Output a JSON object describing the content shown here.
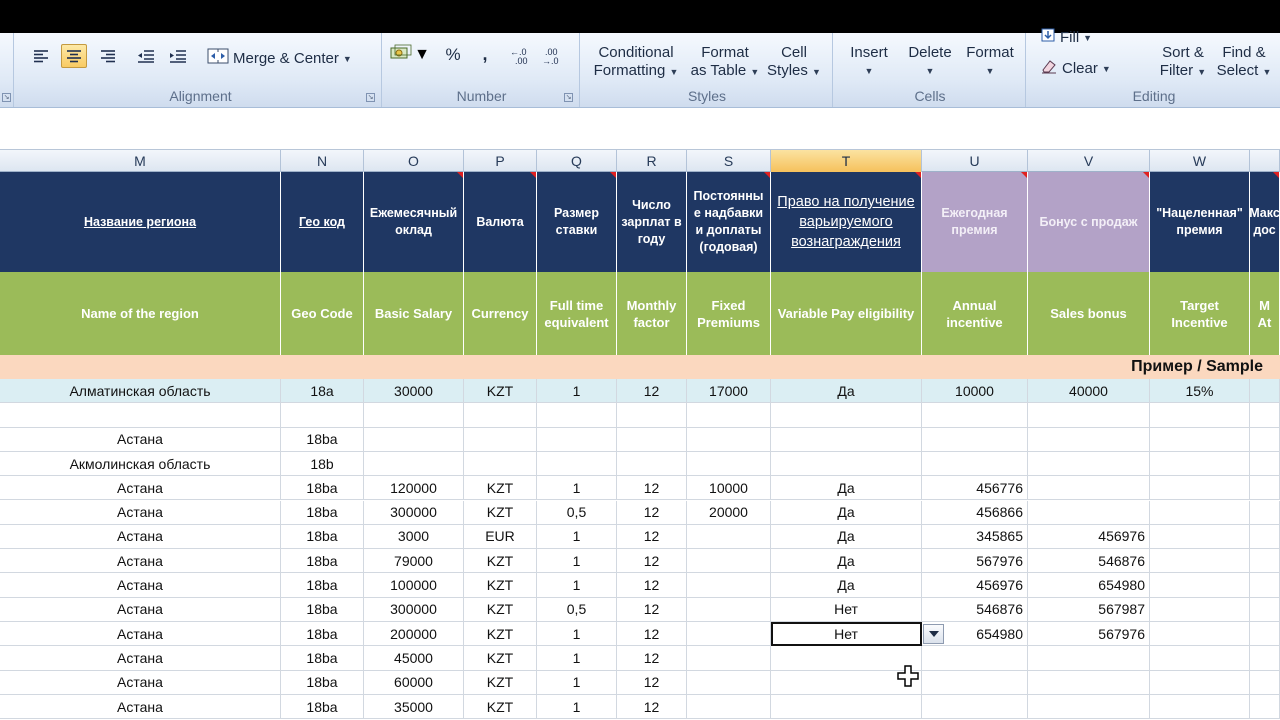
{
  "ribbon": {
    "alignment": {
      "merge_center": "Merge & Center",
      "label": "Alignment"
    },
    "number": {
      "percent": "%",
      "comma": ",",
      "inc_dec": "+.0 .00",
      "dec_dec": ".00 +.0",
      "label": "Number"
    },
    "styles": {
      "conditional": [
        "Conditional",
        "Formatting"
      ],
      "format_table": [
        "Format",
        "as Table"
      ],
      "cell_styles": [
        "Cell",
        "Styles"
      ],
      "label": "Styles"
    },
    "cells": {
      "insert": "Insert",
      "delete": "Delete",
      "format": "Format",
      "label": "Cells"
    },
    "editing": {
      "fill": "Fill",
      "clear": "Clear",
      "sort": [
        "Sort &",
        "Filter"
      ],
      "find": [
        "Find &",
        "Select"
      ],
      "label": "Editing"
    }
  },
  "columns": [
    "M",
    "N",
    "O",
    "P",
    "Q",
    "R",
    "S",
    "T",
    "U",
    "V",
    "W"
  ],
  "selected_column": "T",
  "header_ru": [
    "Название региона",
    "Гео код",
    "Ежемесячный оклад",
    "Валюта",
    "Размер ставки",
    "Число зарплат в году",
    "Постоянны е надбавки и доплаты (годовая)",
    "Право на получение варьируемого вознаграждения",
    "Ежегодная премия",
    "Бонус с продаж",
    "\"Нацеленная\" премия",
    "Макс дос"
  ],
  "header_en": [
    "Name of the region",
    "Geo Code",
    "Basic Salary",
    "Currency",
    "Full time equivalent",
    "Monthly factor",
    "Fixed Premiums",
    "Variable Pay eligibility",
    "Annual incentive",
    "Sales bonus",
    "Target Incentive",
    "M At"
  ],
  "sample_label": "Пример / Sample",
  "sample_row": [
    "Алматинская область",
    "18a",
    "30000",
    "KZT",
    "1",
    "12",
    "17000",
    "Да",
    "10000",
    "40000",
    "15%"
  ],
  "rows": [
    [
      "",
      "",
      "",
      "",
      "",
      "",
      "",
      "",
      "",
      "",
      ""
    ],
    [
      "Астана",
      "18ba",
      "",
      "",
      "",
      "",
      "",
      "",
      "",
      "",
      ""
    ],
    [
      "Акмолинская область",
      "18b",
      "",
      "",
      "",
      "",
      "",
      "",
      "",
      "",
      ""
    ],
    [
      "Астана",
      "18ba",
      "120000",
      "KZT",
      "1",
      "12",
      "10000",
      "Да",
      "456776",
      "",
      ""
    ],
    [
      "Астана",
      "18ba",
      "300000",
      "KZT",
      "0,5",
      "12",
      "20000",
      "Да",
      "456866",
      "",
      ""
    ],
    [
      "Астана",
      "18ba",
      "3000",
      "EUR",
      "1",
      "12",
      "",
      "Да",
      "345865",
      "456976",
      ""
    ],
    [
      "Астана",
      "18ba",
      "79000",
      "KZT",
      "1",
      "12",
      "",
      "Да",
      "567976",
      "546876",
      ""
    ],
    [
      "Астана",
      "18ba",
      "100000",
      "KZT",
      "1",
      "12",
      "",
      "Да",
      "456976",
      "654980",
      ""
    ],
    [
      "Астана",
      "18ba",
      "300000",
      "KZT",
      "0,5",
      "12",
      "",
      "Нет",
      "546876",
      "567987",
      ""
    ],
    [
      "Астана",
      "18ba",
      "200000",
      "KZT",
      "1",
      "12",
      "",
      "Нет",
      "654980",
      "567976",
      ""
    ],
    [
      "Астана",
      "18ba",
      "45000",
      "KZT",
      "1",
      "12",
      "",
      "",
      "",
      "",
      ""
    ],
    [
      "Астана",
      "18ba",
      "60000",
      "KZT",
      "1",
      "12",
      "",
      "",
      "",
      "",
      ""
    ],
    [
      "Астана",
      "18ba",
      "35000",
      "KZT",
      "1",
      "12",
      "",
      "",
      "",
      "",
      ""
    ]
  ],
  "colors": {
    "header_navy": "#1f3763",
    "header_green": "#9bbb59",
    "header_lavender": "#b3a2c7",
    "sample_band": "#fbd8bf",
    "sample_row": "#dbeef3"
  }
}
